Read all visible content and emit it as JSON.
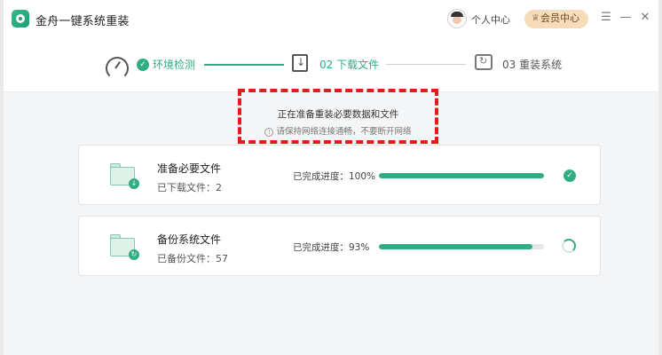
{
  "app": {
    "title": "金舟一键系统重装"
  },
  "header": {
    "user_center": "个人中心",
    "vip_label": "会员中心",
    "vip_icon": "♕"
  },
  "window_controls": {
    "menu": "☰",
    "minimize": "—",
    "close": "✕"
  },
  "steps": [
    {
      "label": "环境检测",
      "state": "done",
      "check": "✓"
    },
    {
      "label": "02 下载文件",
      "state": "active"
    },
    {
      "label": "03 重装系统",
      "state": "pending"
    }
  ],
  "status": {
    "main": "正在准备重装必要数据和文件",
    "info_icon": "!",
    "sub": "请保持网络连接通畅，不要断开网络"
  },
  "tasks": [
    {
      "title": "准备必要文件",
      "sub": "已下载文件：2",
      "progress_label": "已完成进度：100%",
      "progress": 100,
      "badge": "↓",
      "state": "done",
      "done_mark": "✓"
    },
    {
      "title": "备份系统文件",
      "sub": "已备份文件：57",
      "progress_label": "已完成进度：93%",
      "progress": 93,
      "badge": "↻",
      "state": "running"
    }
  ],
  "colors": {
    "accent": "#2eae82",
    "highlight": "#e11b1b",
    "vip_bg": "#f6dcb8"
  }
}
